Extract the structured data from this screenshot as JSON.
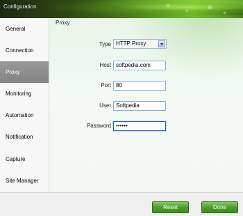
{
  "window": {
    "title": "Configuration"
  },
  "sidebar": {
    "items": [
      {
        "label": "General"
      },
      {
        "label": "Connection"
      },
      {
        "label": "Proxy"
      },
      {
        "label": "Monitoring"
      },
      {
        "label": "Automation"
      },
      {
        "label": "Notification"
      },
      {
        "label": "Capture"
      },
      {
        "label": "Site Manager"
      }
    ],
    "active": "Proxy"
  },
  "panel": {
    "title": "Proxy",
    "type_label": "Type",
    "type_value": "HTTP Proxy",
    "host_label": "Host",
    "host_value": "softpedia.com",
    "port_label": "Port",
    "port_value": "80",
    "user_label": "User",
    "user_value": "Softpedia",
    "password_label": "Password",
    "password_value": "••••••"
  },
  "footer": {
    "reset_label": "Reset",
    "done_label": "Done"
  },
  "colors": {
    "accent_green": "#4f9d2e",
    "active_nav": "#8d8d8d",
    "focus_border": "#2b5fa8"
  }
}
